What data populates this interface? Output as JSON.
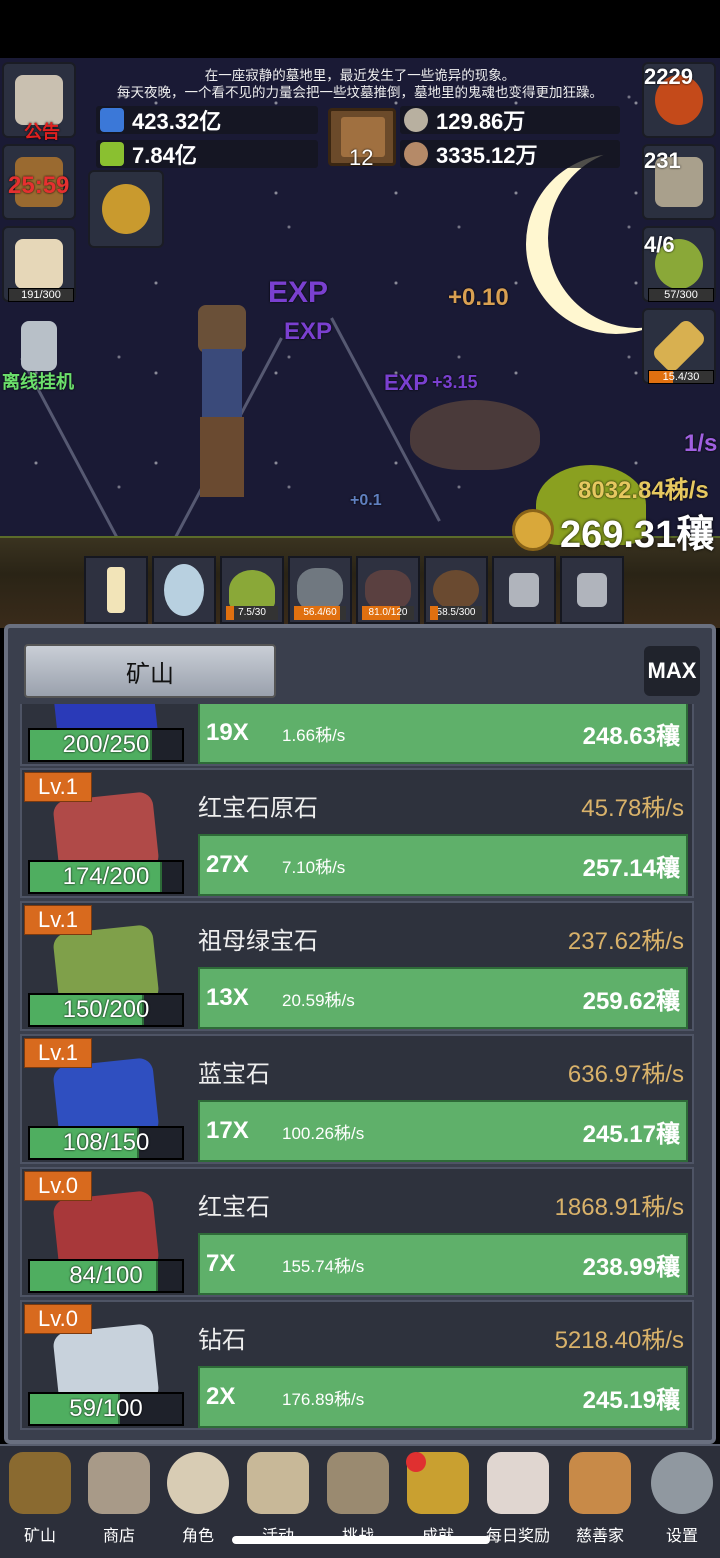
{
  "notice": {
    "line1": "在一座寂静的墓地里，最近发生了一些诡异的现象。",
    "line2": "每天夜晚，一个看不见的力量会把一些坟墓推倒，墓地里的鬼魂也变得更加狂躁。"
  },
  "resources": {
    "blue_potion": "423.32亿",
    "green_potion": "7.84亿",
    "book_count": "12",
    "coin_silver": "129.86万",
    "meat": "3335.12万"
  },
  "left_buttons": {
    "notice_label": "公告",
    "timer": "25:59",
    "brain_progress": "191/300",
    "offline_label": "离线挂机"
  },
  "right_buttons": {
    "potion_count": "2229",
    "chest_count": "231",
    "slime_count": "4/6",
    "slime_progress": "57/300",
    "sword_progress": "15.4/30"
  },
  "battle": {
    "exp1": "EXP",
    "exp2": "EXP",
    "exp3": "EXP",
    "float1": "+0.10",
    "float2": "+3.15",
    "float3": "+0.1",
    "rate_small": "1/s",
    "rate_main": "8032.84秭/s",
    "gold_total": "269.31穰"
  },
  "slots": [
    {
      "name": "candle",
      "tag": ""
    },
    {
      "name": "egg",
      "tag": ""
    },
    {
      "name": "slime",
      "tag": "7.5/30"
    },
    {
      "name": "ghost",
      "tag": "56.4/60"
    },
    {
      "name": "bat",
      "tag": "81.0/120"
    },
    {
      "name": "spider",
      "tag": "58.5/300"
    },
    {
      "name": "lock1",
      "tag": ""
    },
    {
      "name": "lock2",
      "tag": ""
    }
  ],
  "panel": {
    "tab_label": "矿山",
    "max_label": "MAX"
  },
  "mines": [
    {
      "level": "",
      "name": "",
      "rate": "",
      "capacity": "200/250",
      "fill": 0.8,
      "multiplier": "19X",
      "per": "1.66秭/s",
      "cost": "248.63穰",
      "color": "#2a3ab8"
    },
    {
      "level": "Lv.1",
      "name": "红宝石原石",
      "rate": "45.78秭/s",
      "capacity": "174/200",
      "fill": 0.87,
      "multiplier": "27X",
      "per": "7.10秭/s",
      "cost": "257.14穰",
      "color": "#b04a48"
    },
    {
      "level": "Lv.1",
      "name": "祖母绿宝石",
      "rate": "237.62秭/s",
      "capacity": "150/200",
      "fill": 0.75,
      "multiplier": "13X",
      "per": "20.59秭/s",
      "cost": "259.62穰",
      "color": "#7fa04a"
    },
    {
      "level": "Lv.1",
      "name": "蓝宝石",
      "rate": "636.97秭/s",
      "capacity": "108/150",
      "fill": 0.72,
      "multiplier": "17X",
      "per": "100.26秭/s",
      "cost": "245.17穰",
      "color": "#2f4fc0"
    },
    {
      "level": "Lv.0",
      "name": "红宝石",
      "rate": "1868.91秭/s",
      "capacity": "84/100",
      "fill": 0.84,
      "multiplier": "7X",
      "per": "155.74秭/s",
      "cost": "238.99穰",
      "color": "#a8383a"
    },
    {
      "level": "Lv.0",
      "name": "钻石",
      "rate": "5218.40秭/s",
      "capacity": "59/100",
      "fill": 0.59,
      "multiplier": "2X",
      "per": "176.89秭/s",
      "cost": "245.19穰",
      "color": "#c8d2dc"
    }
  ],
  "nav": [
    {
      "id": "mine",
      "label": "矿山",
      "icon": "lantern-icon"
    },
    {
      "id": "shop",
      "label": "商店",
      "icon": "shop-icon"
    },
    {
      "id": "character",
      "label": "角色",
      "icon": "skull-icon"
    },
    {
      "id": "activity",
      "label": "活动",
      "icon": "scroll-icon"
    },
    {
      "id": "challenge",
      "label": "挑战",
      "icon": "map-icon"
    },
    {
      "id": "achievement",
      "label": "成就",
      "icon": "key-icon"
    },
    {
      "id": "daily",
      "label": "每日奖励",
      "icon": "letter-icon"
    },
    {
      "id": "charity",
      "label": "慈善家",
      "icon": "bread-icon"
    },
    {
      "id": "settings",
      "label": "设置",
      "icon": "gear-icon"
    }
  ]
}
